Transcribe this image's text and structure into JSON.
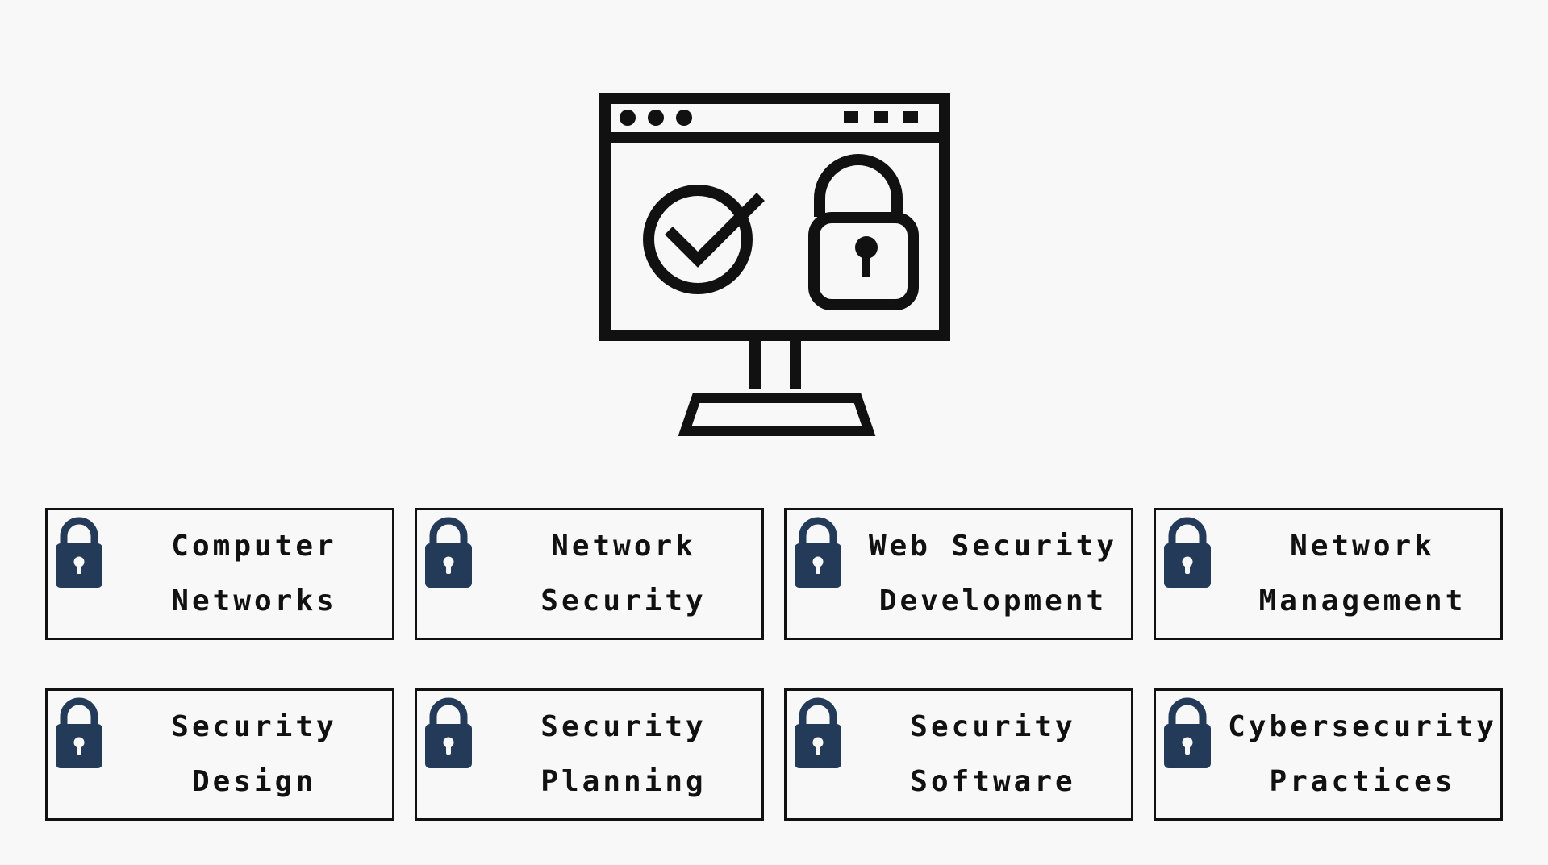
{
  "hero": {
    "icon": "secure-computer-icon"
  },
  "colors": {
    "background": "#f8f8f8",
    "line": "#111111",
    "lock_fill": "#243a59"
  },
  "cards": [
    {
      "icon": "padlock-icon",
      "line1": "Computer",
      "line2": "Networks"
    },
    {
      "icon": "padlock-icon",
      "line1": "Network",
      "line2": "Security"
    },
    {
      "icon": "padlock-icon",
      "line1": "Web Security",
      "line2": "Development"
    },
    {
      "icon": "padlock-icon",
      "line1": "Network",
      "line2": "Management"
    },
    {
      "icon": "padlock-icon",
      "line1": "Security",
      "line2": "Design"
    },
    {
      "icon": "padlock-icon",
      "line1": "Security",
      "line2": "Planning"
    },
    {
      "icon": "padlock-icon",
      "line1": "Security",
      "line2": "Software"
    },
    {
      "icon": "padlock-icon",
      "line1": "Cybersecurity",
      "line2": "Practices"
    }
  ]
}
